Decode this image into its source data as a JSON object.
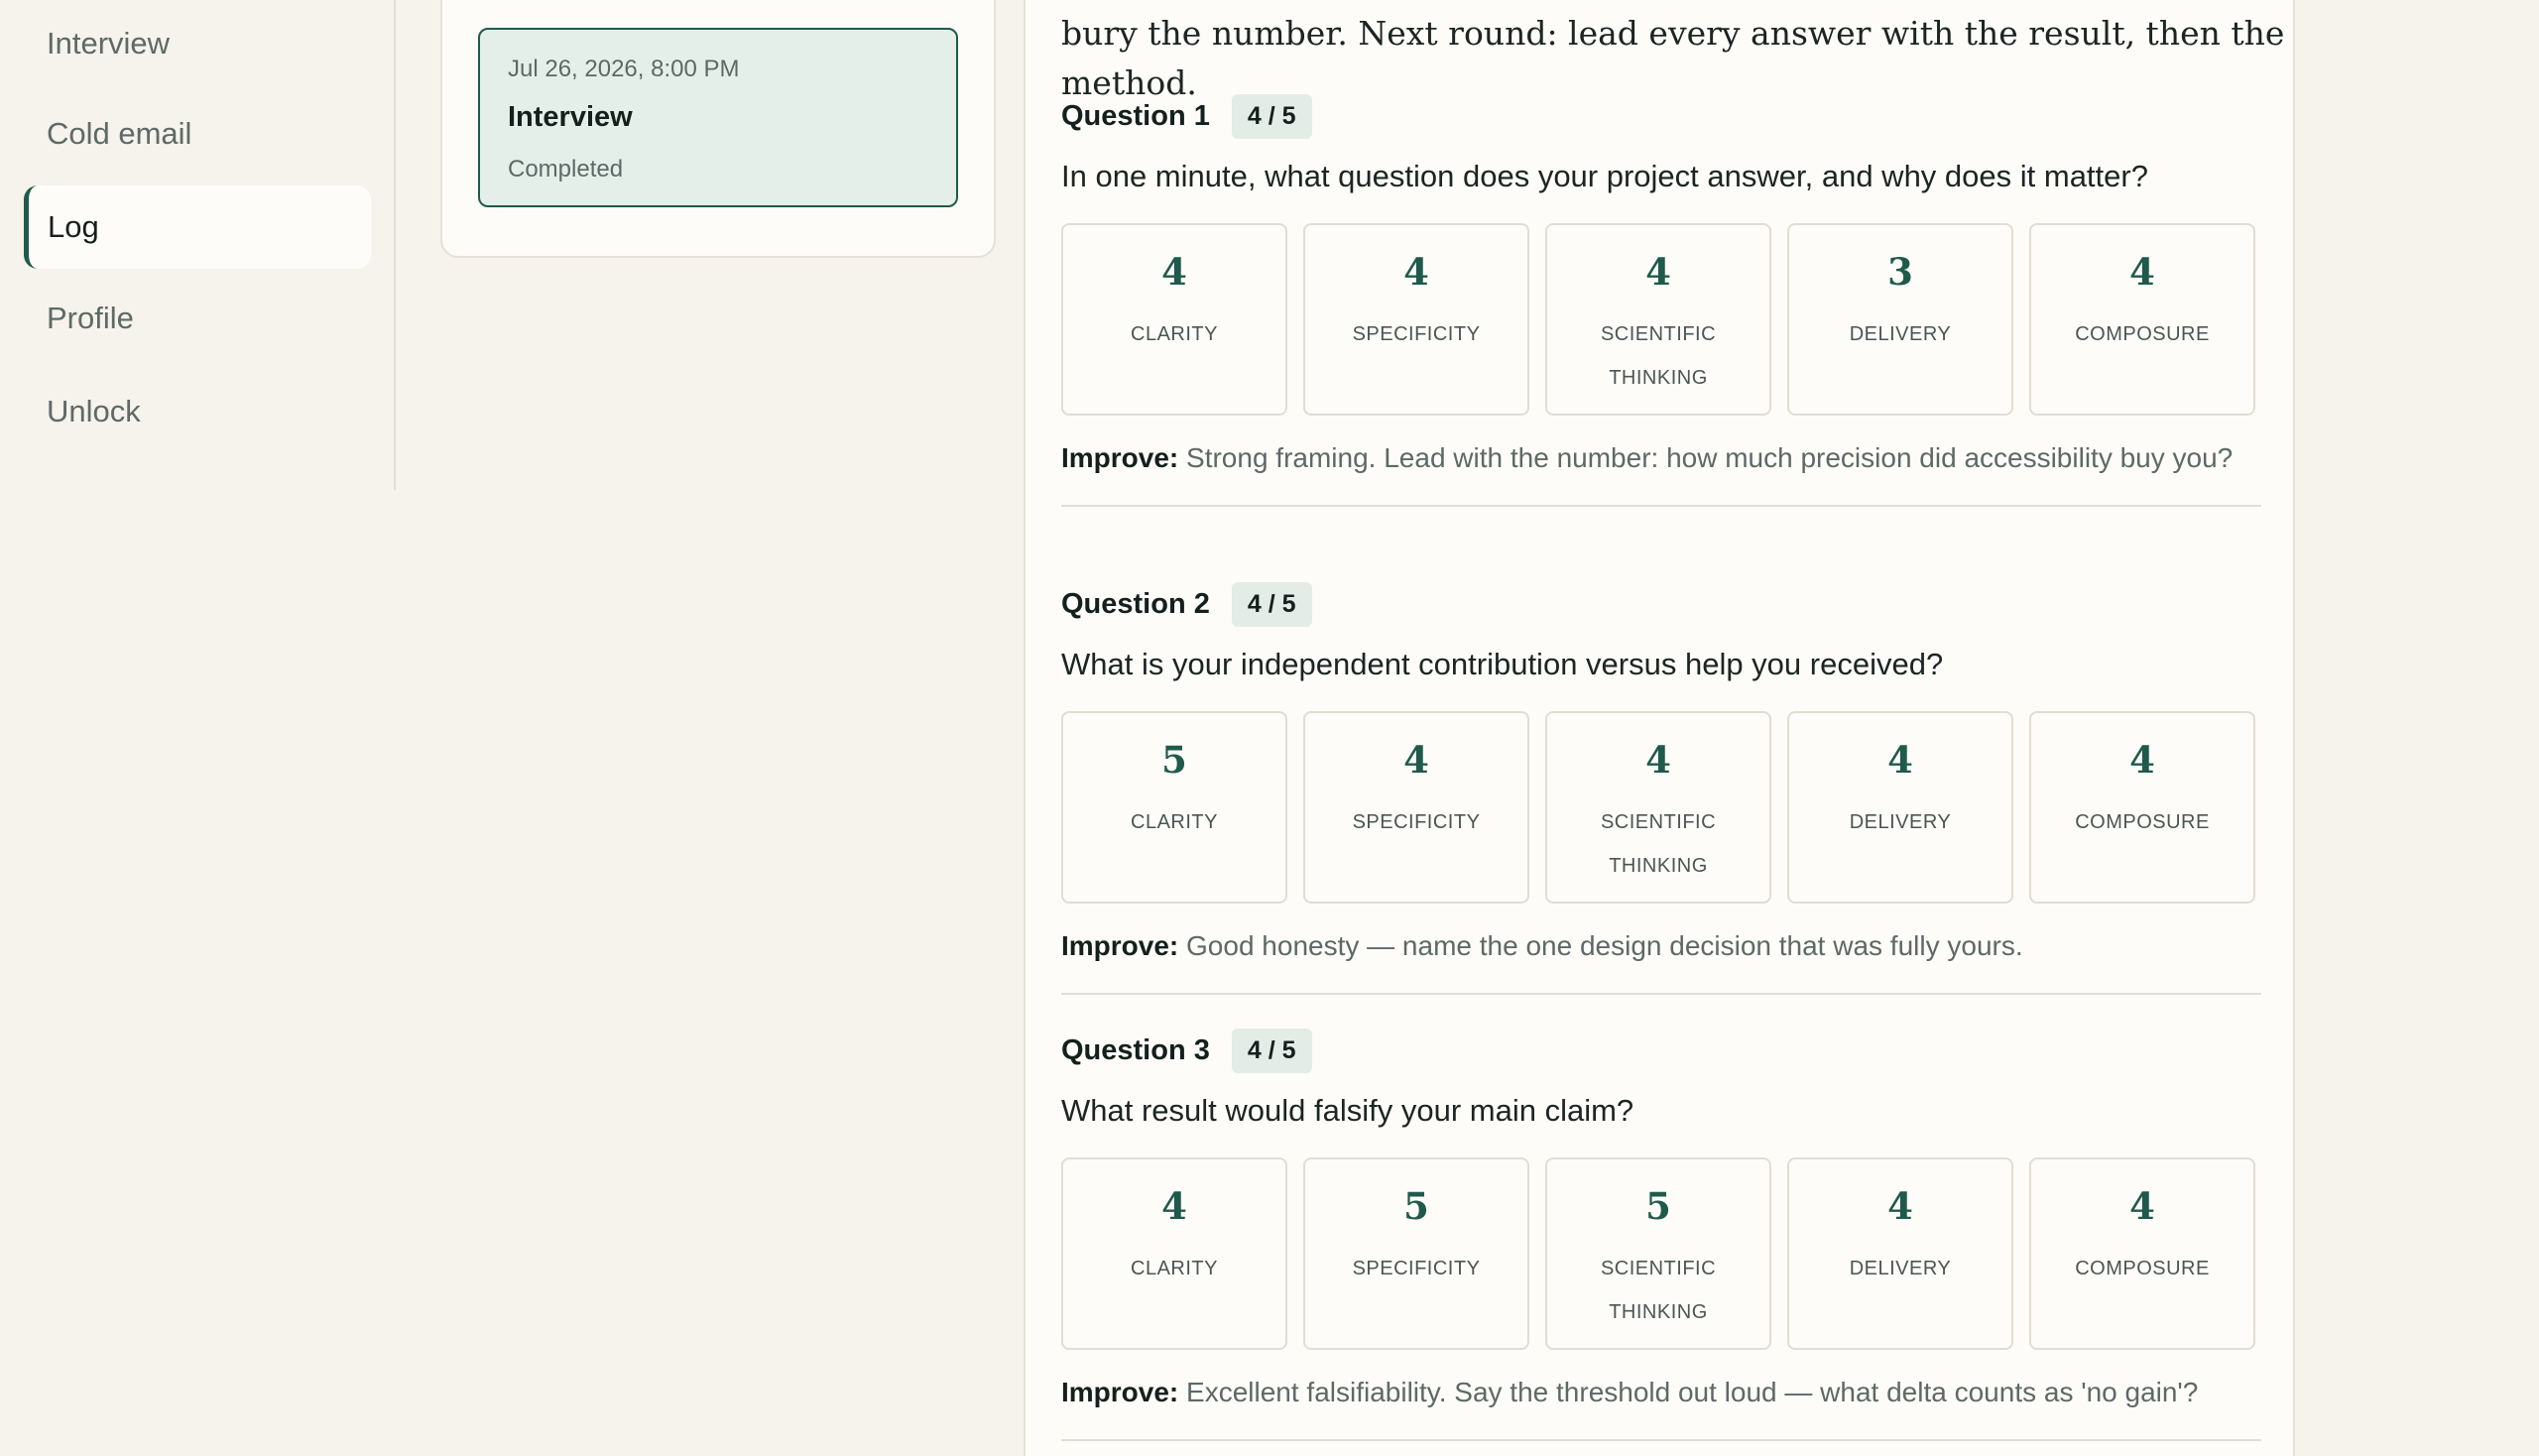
{
  "sidebar": {
    "items": [
      {
        "label": "Interview",
        "active": false
      },
      {
        "label": "Cold email",
        "active": false
      },
      {
        "label": "Log",
        "active": true
      },
      {
        "label": "Profile",
        "active": false
      },
      {
        "label": "Unlock",
        "active": false
      }
    ]
  },
  "sessions": [
    {
      "date": "Jul 26, 2026, 8:00 PM",
      "title": "Interview",
      "status": "Completed"
    }
  ],
  "report": {
    "summary_tail": "bury the number. Next round: lead every answer with the result, then the method.",
    "improve_label": "Improve:",
    "questions": [
      {
        "title": "Question 1",
        "score": "4 / 5",
        "text": "In one minute, what question does your project answer, and why does it matter?",
        "metrics": [
          {
            "value": "4",
            "label": "CLARITY"
          },
          {
            "value": "4",
            "label": "SPECIFICITY"
          },
          {
            "value": "4",
            "label": "SCIENTIFIC THINKING"
          },
          {
            "value": "3",
            "label": "DELIVERY"
          },
          {
            "value": "4",
            "label": "COMPOSURE"
          }
        ],
        "improve": "Strong framing. Lead with the number: how much precision did accessibility buy you?"
      },
      {
        "title": "Question 2",
        "score": "4 / 5",
        "text": "What is your independent contribution versus help you received?",
        "metrics": [
          {
            "value": "5",
            "label": "CLARITY"
          },
          {
            "value": "4",
            "label": "SPECIFICITY"
          },
          {
            "value": "4",
            "label": "SCIENTIFIC THINKING"
          },
          {
            "value": "4",
            "label": "DELIVERY"
          },
          {
            "value": "4",
            "label": "COMPOSURE"
          }
        ],
        "improve": "Good honesty — name the one design decision that was fully yours."
      },
      {
        "title": "Question 3",
        "score": "4 / 5",
        "text": "What result would falsify your main claim?",
        "metrics": [
          {
            "value": "4",
            "label": "CLARITY"
          },
          {
            "value": "5",
            "label": "SPECIFICITY"
          },
          {
            "value": "5",
            "label": "SCIENTIFIC THINKING"
          },
          {
            "value": "4",
            "label": "DELIVERY"
          },
          {
            "value": "4",
            "label": "COMPOSURE"
          }
        ],
        "improve": "Excellent falsifiability. Say the threshold out loud — what delta counts as 'no gain'?"
      }
    ]
  }
}
